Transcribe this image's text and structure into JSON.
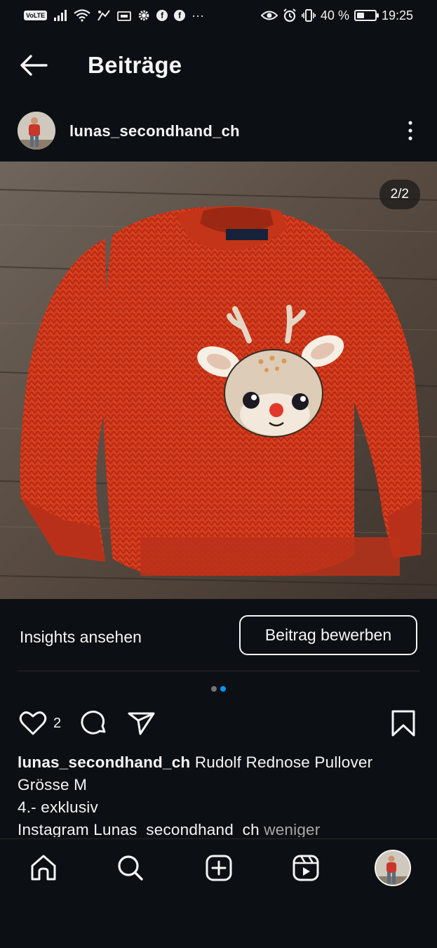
{
  "status_bar": {
    "volte": "VoLTE",
    "wifi_sub": "4G",
    "more": "···",
    "battery_pct": "40 %",
    "battery_level": 0.4,
    "time": "19:25",
    "icons": [
      "signal-icon",
      "wifi-icon",
      "alarm-off-icon",
      "ai-box-icon",
      "settings-icon",
      "facebook-icon",
      "facebook-icon",
      "eye-icon",
      "alarm-icon",
      "vibrate-icon",
      "battery-icon"
    ]
  },
  "header": {
    "title": "Beiträge"
  },
  "post": {
    "username": "lunas_secondhand_ch",
    "image_counter": "2/2",
    "slide_count": 2,
    "active_slide": 2,
    "like_count": "2"
  },
  "insights": {
    "view_label": "Insights ansehen",
    "promote_label": "Beitrag bewerben"
  },
  "caption": {
    "username": "lunas_secondhand_ch",
    "line1": "Rudolf Rednose Pullover",
    "line2": "Grösse M",
    "line3": "4.- exklusiv",
    "line4": "Instagram Lunas_secondhand_ch",
    "less": "weniger"
  },
  "colors": {
    "background": "#0c1014",
    "text": "#f5f5f5",
    "muted": "#a8a8a8",
    "accent": "#0095f6",
    "sweater": "#d33a1c"
  },
  "nav": {
    "items": [
      "home-icon",
      "search-icon",
      "create-icon",
      "reels-icon",
      "profile-avatar"
    ]
  }
}
